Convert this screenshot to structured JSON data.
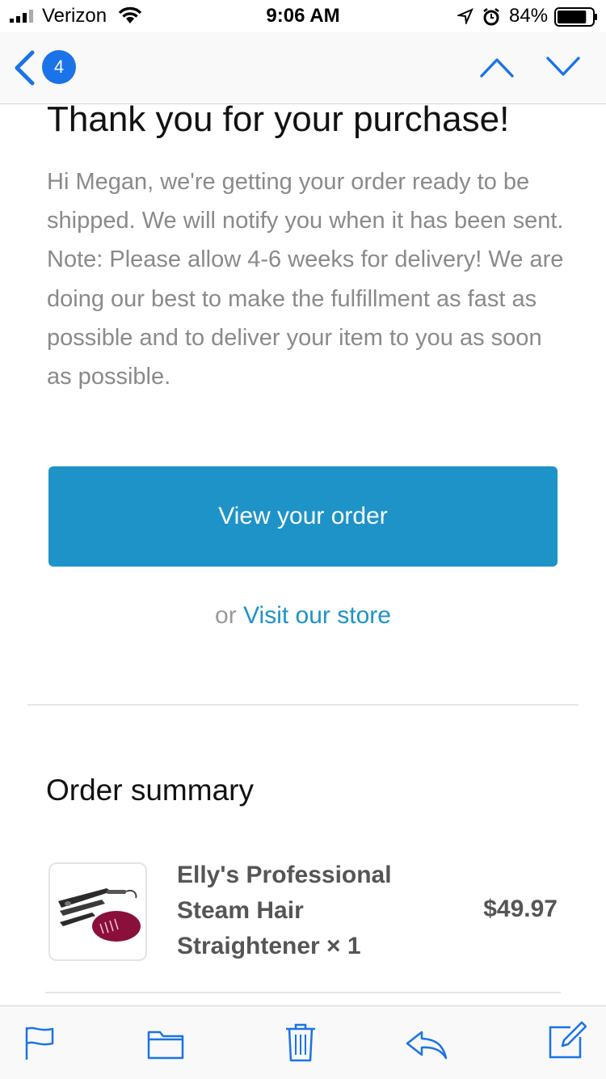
{
  "status_bar": {
    "carrier": "Verizon",
    "time": "9:06 AM",
    "battery_percent": "84%",
    "battery_level": 0.84,
    "icons": [
      "signal-icon",
      "wifi-icon",
      "location-icon",
      "alarm-icon",
      "battery-icon"
    ]
  },
  "nav": {
    "badge_count": "4",
    "icons": [
      "back-chevron-icon",
      "chevron-up-icon",
      "chevron-down-icon"
    ]
  },
  "email": {
    "title": "Thank you for your purchase!",
    "message": "Hi Megan, we're getting your order ready to be shipped. We will notify you when it has been sent. Note: Please allow 4-6 weeks for delivery! We are doing our best to make the fulfillment as fast as possible and to deliver your item to you as soon as possible.",
    "view_order_label": "View your order",
    "or_text": "or",
    "visit_store_label": "Visit our store",
    "summary_heading": "Order summary",
    "items": [
      {
        "name": "Elly's Professional Steam Hair Straightener × 1",
        "price": "$49.97",
        "thumbnail_icon": "hair-straightener-image"
      }
    ]
  },
  "toolbar": {
    "icons": [
      "flag-icon",
      "folder-icon",
      "trash-icon",
      "reply-icon",
      "compose-icon"
    ]
  },
  "colors": {
    "ios_blue": "#1a73e8",
    "button_blue": "#1d93c8",
    "body_text_gray": "#8a8a8a"
  }
}
